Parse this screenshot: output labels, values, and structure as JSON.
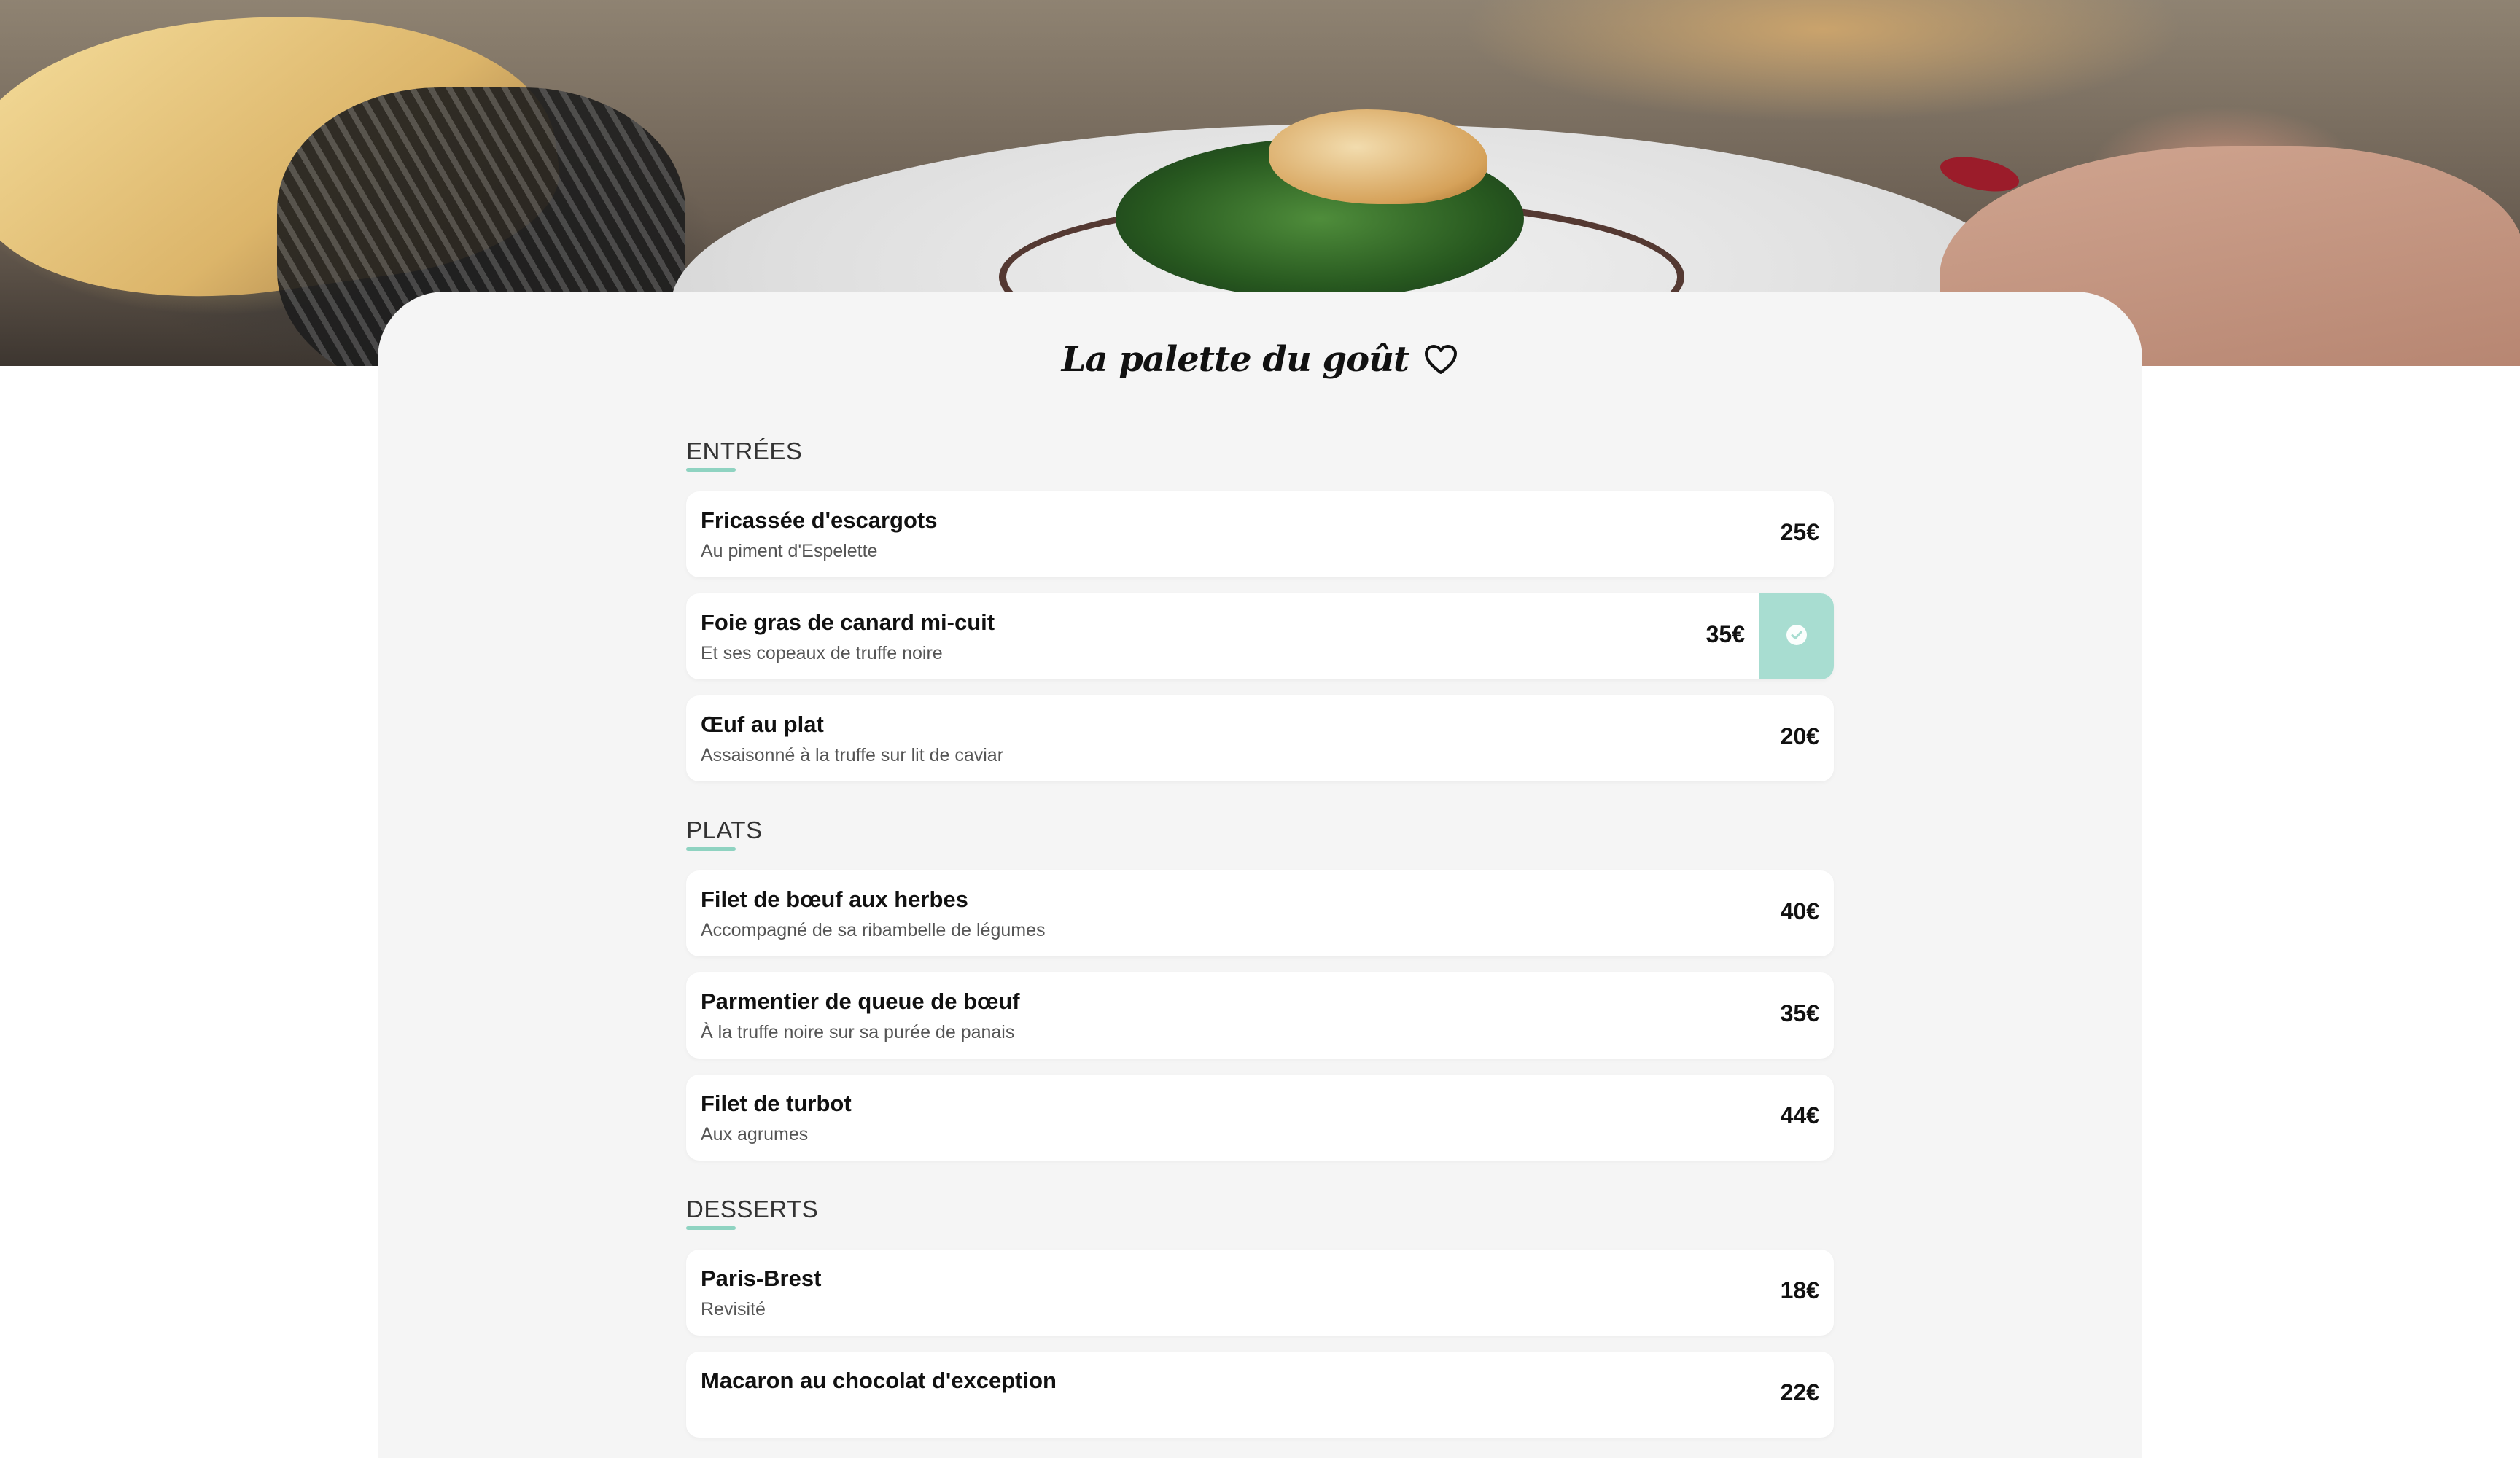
{
  "restaurant": {
    "name": "La palette du goût",
    "favorite_icon": "heart-outline-icon",
    "accent_color": "#8fd3c1",
    "selected_color": "#a8ddd1"
  },
  "sections": [
    {
      "title": "ENTRÉES",
      "items": [
        {
          "name": "Fricassée d'escargots",
          "desc": "Au piment d'Espelette",
          "price": "25€",
          "selected": false
        },
        {
          "name": "Foie gras de canard mi-cuit",
          "desc": "Et ses copeaux de truffe noire",
          "price": "35€",
          "selected": true
        },
        {
          "name": "Œuf au plat",
          "desc": "Assaisonné à la truffe sur lit de caviar",
          "price": "20€",
          "selected": false
        }
      ]
    },
    {
      "title": "PLATS",
      "items": [
        {
          "name": "Filet de bœuf aux herbes",
          "desc": "Accompagné de sa ribambelle de légumes",
          "price": "40€",
          "selected": false
        },
        {
          "name": "Parmentier de queue de bœuf",
          "desc": "À la truffe noire sur sa purée de panais",
          "price": "35€",
          "selected": false
        },
        {
          "name": "Filet de turbot",
          "desc": "Aux agrumes",
          "price": "44€",
          "selected": false
        }
      ]
    },
    {
      "title": "DESSERTS",
      "items": [
        {
          "name": "Paris-Brest",
          "desc": "Revisité",
          "price": "18€",
          "selected": false
        },
        {
          "name": "Macaron au chocolat d'exception",
          "desc": "",
          "price": "22€",
          "selected": false
        }
      ]
    }
  ]
}
